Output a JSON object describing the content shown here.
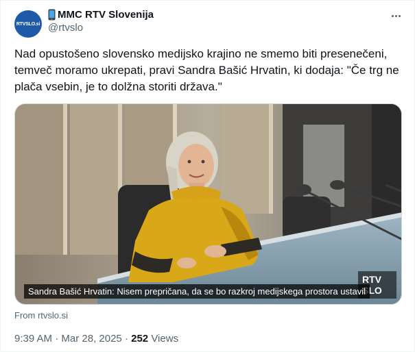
{
  "account": {
    "avatar_text": "RTVSLO.si",
    "display_name": "MMC RTV Slovenija",
    "handle": "@rtvslo",
    "name_icon": "mobile-phone-icon"
  },
  "tweet": {
    "text": "Nad opustošeno slovensko medijsko krajino ne smemo biti presenečeni, temveč moramo ukrepati, pravi Sandra Bašić Hrvatin, ki dodaja: \"Če trg ne plača vsebin, je to dolžna storiti država.\"",
    "media_caption": "Sandra Bašić Hrvatin: Nisem prepričana, da se bo razkroj medijskega prostora ustavil",
    "media_logo_line1": "RTV",
    "media_logo_line2": "SLO",
    "from_label": "From rtvslo.si",
    "time": "9:39 AM",
    "date": "Mar 28, 2025",
    "separator": "·",
    "views_count": "252",
    "views_label": "Views"
  },
  "colors": {
    "avatar_bg": "#1f5aa8",
    "secondary_text": "#536471",
    "primary_text": "#0f1419"
  }
}
